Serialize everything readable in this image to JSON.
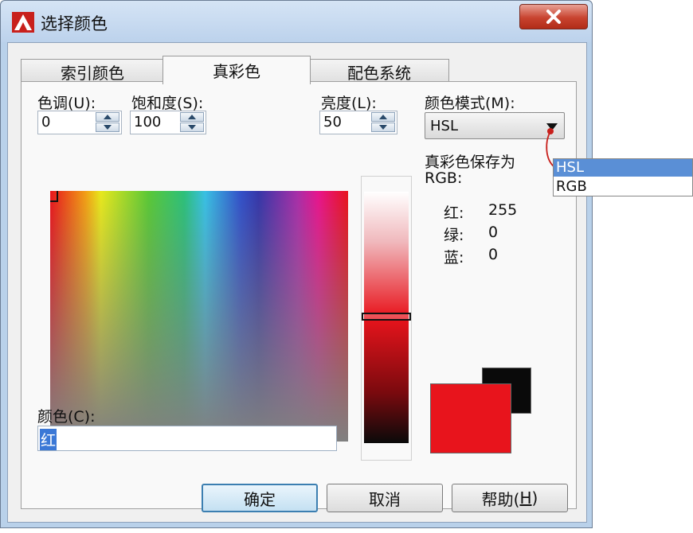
{
  "window": {
    "title": "选择颜色"
  },
  "tabs": [
    {
      "label": "索引颜色"
    },
    {
      "label": "真彩色"
    },
    {
      "label": "配色系统"
    }
  ],
  "hue": {
    "label": "色调(U):",
    "value": "0"
  },
  "saturation": {
    "label": "饱和度(S):",
    "value": "100"
  },
  "luminance": {
    "label": "亮度(L):",
    "value": "50"
  },
  "color_model": {
    "label": "颜色模式(M):",
    "selected": "HSL",
    "options": [
      "HSL",
      "RGB"
    ]
  },
  "truecolor_saved_as": {
    "line1": "真彩色保存为",
    "line2": "RGB:"
  },
  "rgb": {
    "red_label": "红:",
    "red_value": "255",
    "green_label": "绿:",
    "green_value": "0",
    "blue_label": "蓝:",
    "blue_value": "0"
  },
  "color_name": {
    "label": "颜色(C):",
    "value": "红"
  },
  "buttons": {
    "ok": "确定",
    "cancel": "取消",
    "help_prefix": "帮助(",
    "help_key": "H",
    "help_suffix": ")"
  },
  "colors": {
    "current": "#e8141c",
    "previous": "#0a0a0a",
    "accent": "#5a8fd6"
  }
}
